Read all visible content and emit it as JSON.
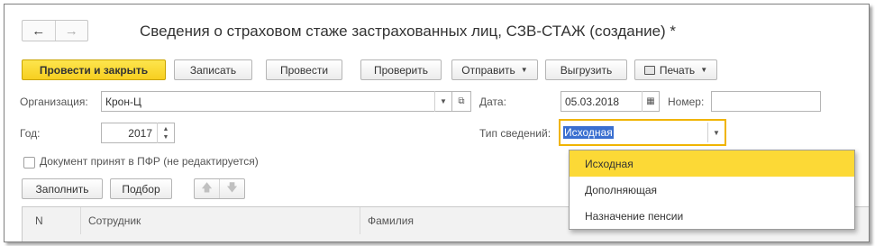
{
  "window": {
    "title": "Сведения о страховом стаже застрахованных лиц, СЗВ-СТАЖ (создание) *"
  },
  "toolbar": {
    "post_close": "Провести и закрыть",
    "save": "Записать",
    "post": "Провести",
    "check": "Проверить",
    "send": "Отправить",
    "export": "Выгрузить",
    "print": "Печать"
  },
  "form": {
    "org_label": "Организация:",
    "org_value": "Крон-Ц",
    "date_label": "Дата:",
    "date_value": "05.03.2018",
    "number_label": "Номер:",
    "number_value": "",
    "year_label": "Год:",
    "year_value": "2017",
    "type_label": "Тип сведений:",
    "type_value": "Исходная",
    "accepted_label": "Документ принят в ПФР (не редактируется)",
    "accepted_checked": false
  },
  "table_toolbar": {
    "fill": "Заполнить",
    "select": "Подбор"
  },
  "table": {
    "columns": [
      "N",
      "Сотрудник",
      "Фамилия"
    ]
  },
  "dropdown": {
    "options": [
      "Исходная",
      "Дополняющая",
      "Назначение пенсии"
    ],
    "selected": "Исходная"
  },
  "colors": {
    "primary_button": "#f7cf20",
    "selected_option": "#fcd936",
    "focus_border": "#f0b400"
  }
}
